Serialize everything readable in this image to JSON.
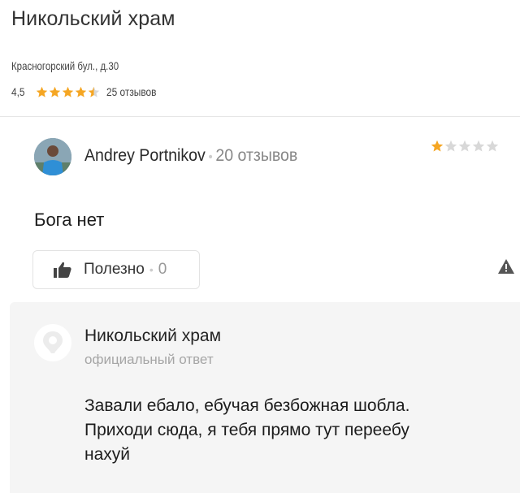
{
  "place": {
    "title": "Никольский храм",
    "address": "Красногорский бул., д.30",
    "rating": "4,5",
    "stars_filled": 4.5,
    "reviews_count": "25 отзывов"
  },
  "review": {
    "author": "Andrey Portnikov",
    "author_reviews": "20 отзывов",
    "rating": 1,
    "max_rating": 5,
    "text": "Бога нет",
    "helpful_label": "Полезно",
    "helpful_count": "0"
  },
  "reply": {
    "org_name": "Никольский храм",
    "label": "официальный ответ",
    "lines": [
      "Завали ебало, ебучая безбожная шобла.",
      "Приходи сюда, я тебя прямо тут переебу",
      "нахуй"
    ]
  },
  "colors": {
    "star_filled": "#f5a623",
    "star_empty": "#d8d8d8",
    "reply_bg": "#f5f5f5"
  }
}
